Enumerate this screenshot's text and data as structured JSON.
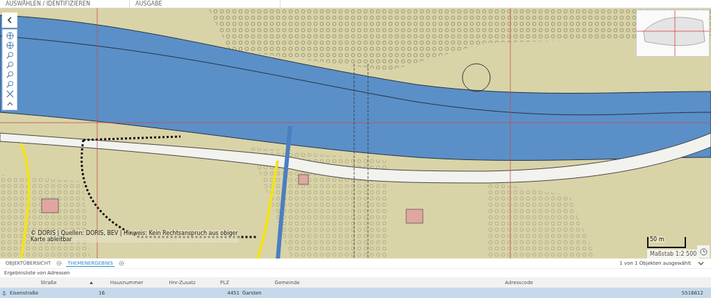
{
  "top_bar": {
    "sections": [
      "AUSWÄHLEN / IDENTIFIZIEREN",
      "AUSGABE"
    ]
  },
  "map": {
    "attribution": "© DORIS | Quellen: DORIS, BEV | Hinweis: Kein Rechtsanspruch aus obiger Karte ableitbar",
    "scale_bar": "50 m",
    "scale": "Maßstab 1:2 500"
  },
  "bottom_panel": {
    "tabs": [
      {
        "label": "OBJEKTÜBERSICHT",
        "selected": false
      },
      {
        "label": "THEMENERGEBNIS",
        "selected": true
      }
    ],
    "selection_info": "1 von 1 Objekten ausgewählt",
    "list_title": "Ergebnisliste von Adressen",
    "table": {
      "columns": [
        {
          "label": "Straße",
          "sorted": true
        },
        {
          "label": "Hausnummer",
          "sorted": false
        },
        {
          "label": "Hnr-Zusatz",
          "sorted": false
        },
        {
          "label": "PLZ",
          "sorted": false
        },
        {
          "label": "Gemeinde",
          "sorted": false
        },
        {
          "label": "Adresscode",
          "sorted": false
        }
      ],
      "rows": [
        {
          "selected": true,
          "cells": [
            "Eisenstraße",
            "16",
            "",
            "4451",
            "Garsten",
            "5516612"
          ]
        }
      ]
    }
  }
}
